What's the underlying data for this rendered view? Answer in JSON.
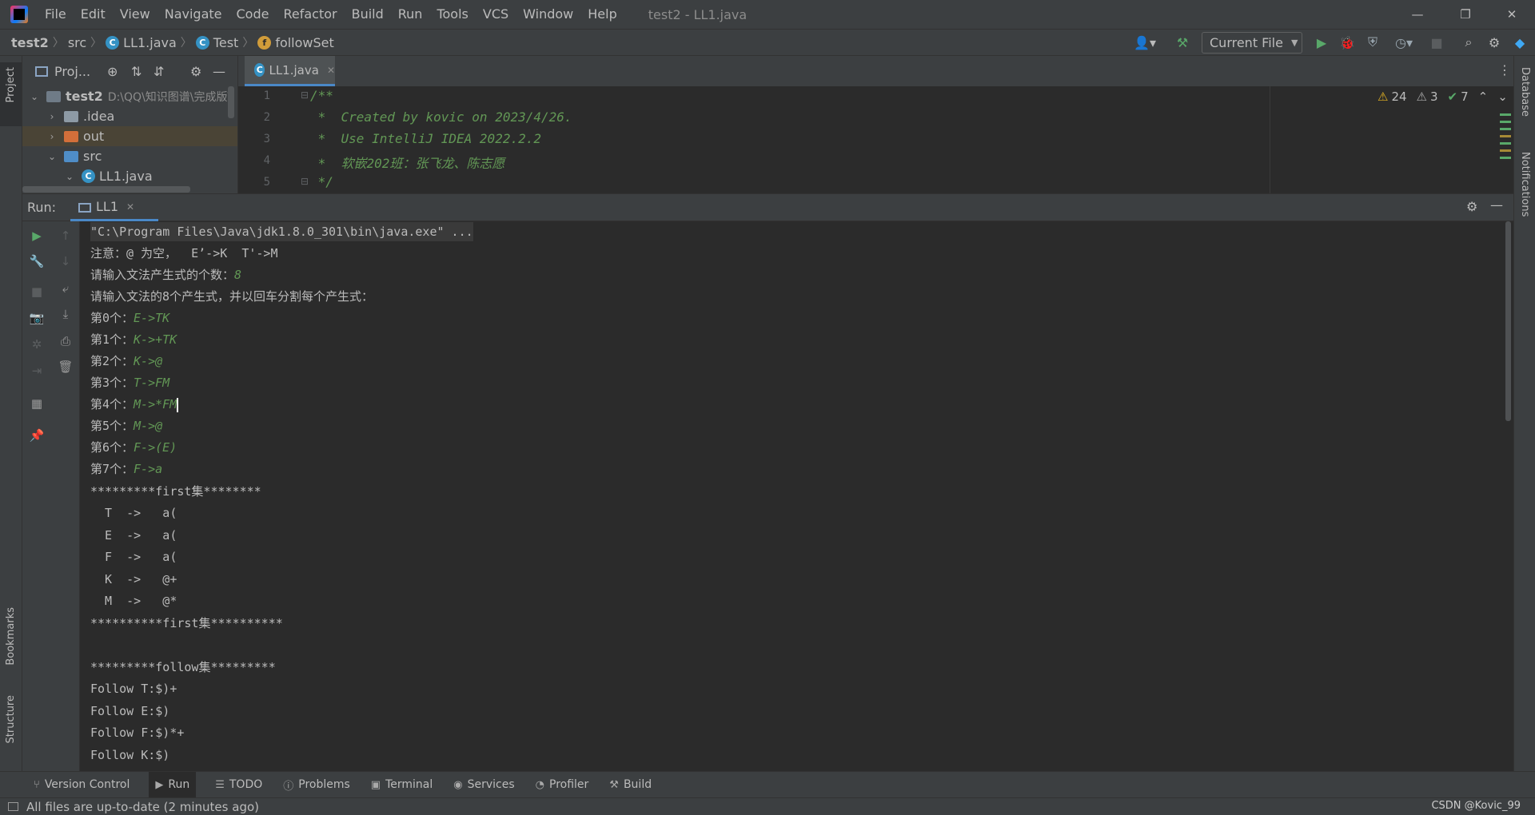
{
  "menu": [
    "File",
    "Edit",
    "View",
    "Navigate",
    "Code",
    "Refactor",
    "Build",
    "Run",
    "Tools",
    "VCS",
    "Window",
    "Help"
  ],
  "window_title": "test2 - LL1.java",
  "breadcrumbs": {
    "project": "test2",
    "src": "src",
    "file": "LL1.java",
    "class": "Test",
    "method": "followSet"
  },
  "run_config": "Current File",
  "project_panel": {
    "title": "Proj...",
    "tree": [
      {
        "label": "test2",
        "path": "D:\\QQ\\知识图谱\\完成版\\"
      },
      {
        "label": ".idea"
      },
      {
        "label": "out"
      },
      {
        "label": "src"
      },
      {
        "label": "LL1.java"
      }
    ]
  },
  "editor": {
    "tab": "LL1.java",
    "line_numbers": [
      "1",
      "2",
      "3",
      "4",
      "5"
    ],
    "lines": [
      "/**",
      " *  Created by kovic on 2023/4/26.",
      " *  Use IntelliJ IDEA 2022.2.2",
      " *  软嵌202班：张飞龙、陈志愿",
      " */"
    ],
    "inspections": {
      "warnings": "24",
      "weak_warnings": "3",
      "typos": "7"
    }
  },
  "run_panel": {
    "title": "Run:",
    "tab": "LL1",
    "console": [
      {
        "text": "\"C:\\Program Files\\Java\\jdk1.8.0_301\\bin\\java.exe\" ...",
        "input": ""
      },
      {
        "text": "注意：@ 为空，  E’->K  T'->M",
        "input": ""
      },
      {
        "text": "请输入文法产生式的个数：",
        "input": "8"
      },
      {
        "text": "请输入文法的8个产生式，并以回车分割每个产生式：",
        "input": ""
      },
      {
        "text": "第0个：",
        "input": "E->TK"
      },
      {
        "text": "第1个：",
        "input": "K->+TK"
      },
      {
        "text": "第2个：",
        "input": "K->@"
      },
      {
        "text": "第3个：",
        "input": "T->FM"
      },
      {
        "text": "第4个：",
        "input": "M->*FM"
      },
      {
        "text": "第5个：",
        "input": "M->@"
      },
      {
        "text": "第6个：",
        "input": "F->(E)"
      },
      {
        "text": "第7个：",
        "input": "F->a"
      },
      {
        "text": "*********first集********",
        "input": ""
      },
      {
        "text": "  T  ->   a(",
        "input": ""
      },
      {
        "text": "  E  ->   a(",
        "input": ""
      },
      {
        "text": "  F  ->   a(",
        "input": ""
      },
      {
        "text": "  K  ->   @+",
        "input": ""
      },
      {
        "text": "  M  ->   @*",
        "input": ""
      },
      {
        "text": "**********first集**********",
        "input": ""
      },
      {
        "text": "",
        "input": ""
      },
      {
        "text": "*********follow集*********",
        "input": ""
      },
      {
        "text": "Follow T:$)+",
        "input": ""
      },
      {
        "text": "Follow E:$)",
        "input": ""
      },
      {
        "text": "Follow F:$)*+",
        "input": ""
      },
      {
        "text": "Follow K:$)",
        "input": ""
      }
    ]
  },
  "side_labels": {
    "project": "Project",
    "bookmarks": "Bookmarks",
    "structure": "Structure",
    "database": "Database",
    "notifications": "Notifications"
  },
  "bottom_tools": [
    "Version Control",
    "Run",
    "TODO",
    "Problems",
    "Terminal",
    "Services",
    "Profiler",
    "Build"
  ],
  "status": "All files are up-to-date (2 minutes ago)",
  "watermark": "CSDN @Kovic_99",
  "colors": {
    "accent": "#4a88c7",
    "input_green": "#629755",
    "bg": "#2b2b2b",
    "panel": "#3c3f41"
  }
}
